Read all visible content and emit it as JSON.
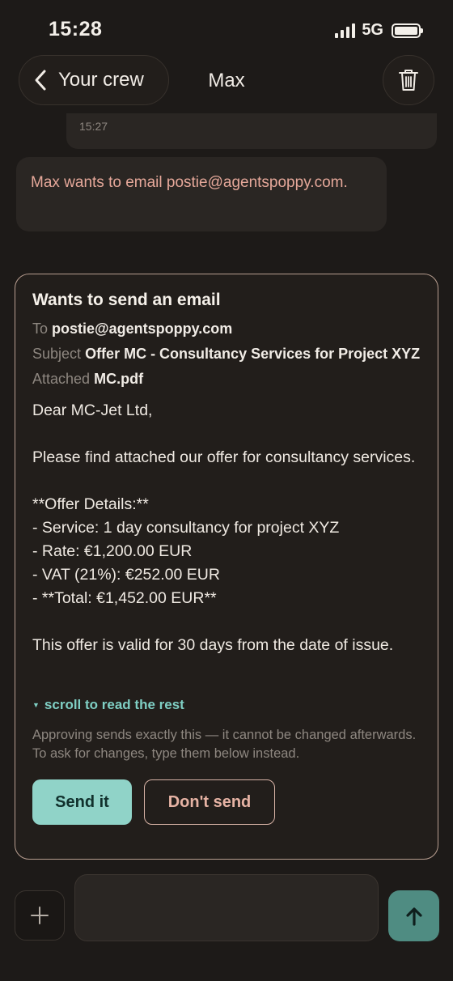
{
  "status_bar": {
    "time": "15:28",
    "network": "5G"
  },
  "nav": {
    "back_label": "Your crew",
    "title": "Max"
  },
  "previous_message": {
    "time": "15:27"
  },
  "info_bubble": {
    "text": "Max wants to email postie@agentspoppy.com."
  },
  "email_card": {
    "title": "Wants to send an email",
    "to_label": "To",
    "to_value": "postie@agentspoppy.com",
    "subject_label": "Subject",
    "subject_value": "Offer MC - Consultancy Services for Project XYZ",
    "attached_label": "Attached",
    "attached_value": "MC.pdf",
    "body": "Dear MC-Jet Ltd,\n\nPlease find attached our offer for consultancy services.\n\n**Offer Details:**\n- Service: 1 day consultancy for project XYZ\n- Rate: €1,200.00 EUR\n- VAT (21%): €252.00 EUR\n- **Total: €1,452.00 EUR**\n\nThis offer is valid for 30 days from the date of issue.",
    "scroll_hint": "scroll to read the rest",
    "warning": "Approving sends exactly this — it cannot be changed afterwards. To ask for changes, type them below instead.",
    "send_label": "Send it",
    "dont_send_label": "Don't send"
  },
  "composer": {
    "value": ""
  },
  "colors": {
    "background": "#1d1a18",
    "bubble": "#2a2623",
    "info_text": "#e6a89a",
    "accent_teal": "#90d3c8",
    "card_border": "#b89e90",
    "send_arrow_bg": "#4f8c82"
  },
  "icons": {
    "back": "chevron-left-icon",
    "trash": "trash-icon",
    "plus": "plus-icon",
    "send": "arrow-up-icon",
    "scroll": "triangle-down-icon"
  }
}
